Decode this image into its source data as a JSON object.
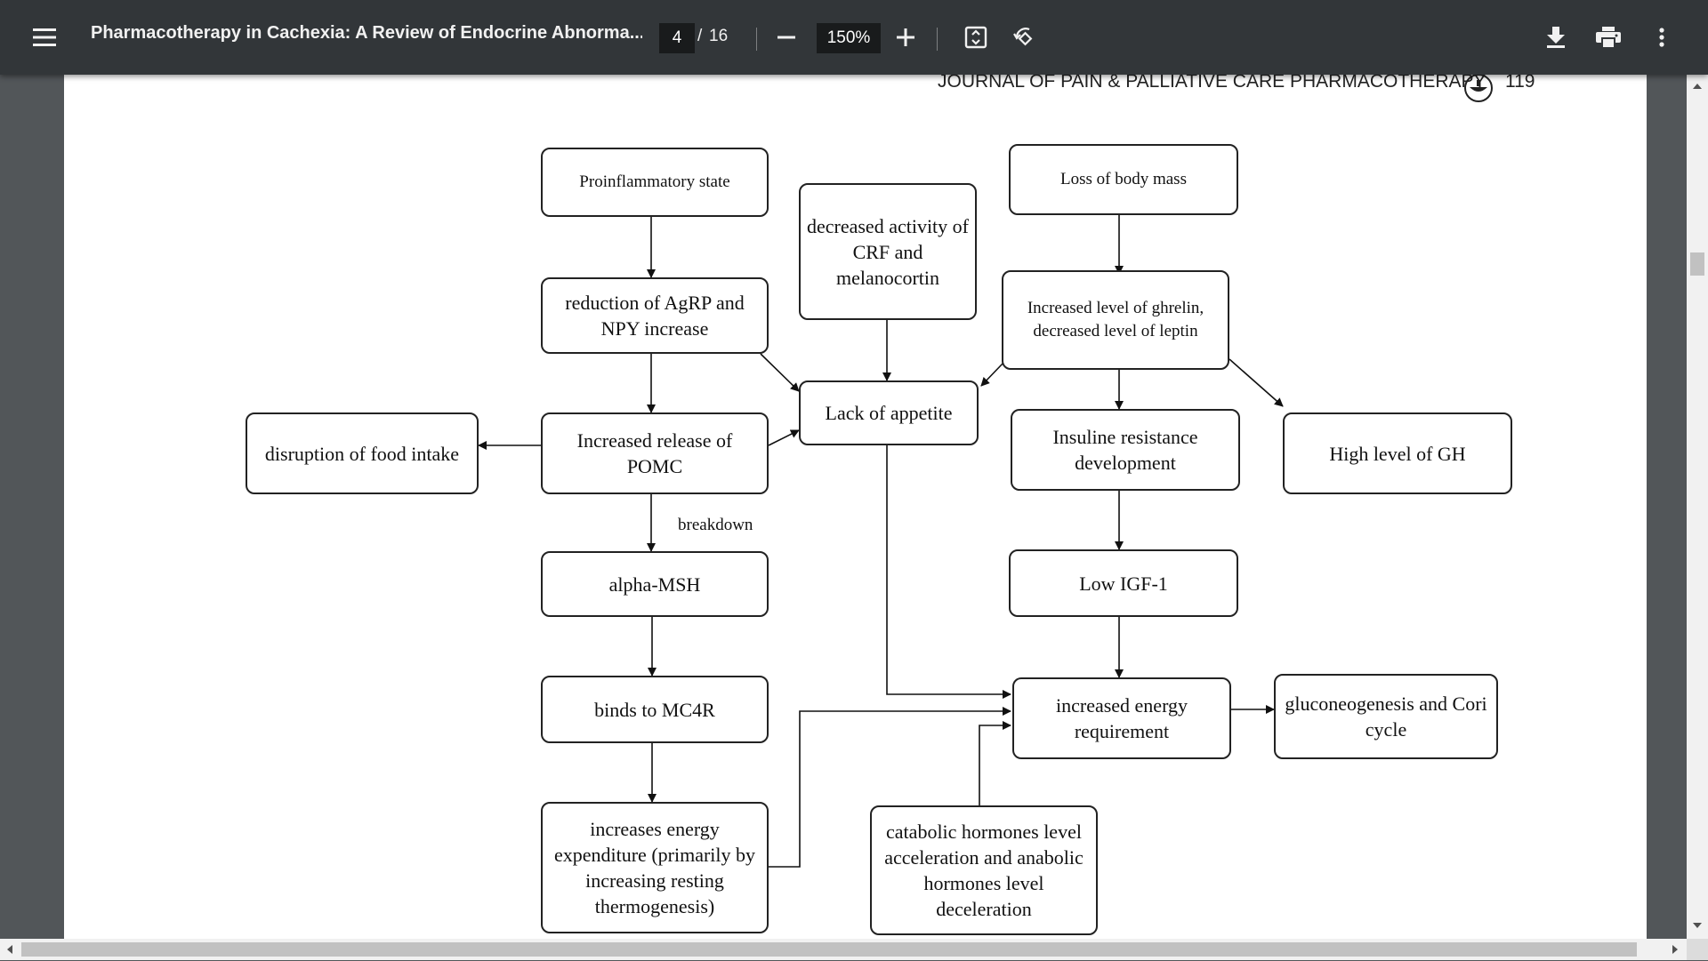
{
  "toolbar": {
    "menu_icon": "hamburger-menu-icon",
    "title": "Pharmacotherapy in Cachexia: A Review of Endocrine Abnorma...",
    "page_current": "4",
    "page_separator": "/",
    "page_total": "16",
    "zoom_out_icon": "minus-icon",
    "zoom_value": "150%",
    "zoom_in_icon": "plus-icon",
    "fit_icon": "fit-to-page-icon",
    "rotate_icon": "rotate-counterclockwise-icon",
    "download_icon": "download-icon",
    "print_icon": "print-icon",
    "more_icon": "more-vertical-icon"
  },
  "page": {
    "running_head": "JOURNAL OF PAIN & PALLIATIVE CARE PHARMACOTHERAPY",
    "page_number": "119",
    "publisher_logo": "publisher-logo-icon"
  },
  "diagram": {
    "proinflammatory": "Proinflammatory state",
    "agrp": "reduction of AgRP and NPY increase",
    "pomc": "Increased release of POMC",
    "disruption": "disruption of food intake",
    "breakdown": "breakdown",
    "alpha_msh": "alpha-MSH",
    "mc4r": "binds to MC4R",
    "energy_expenditure": "increases energy expenditure (primarily by increasing resting thermogenesis)",
    "crf": "decreased activity of CRF and melanocortin",
    "lack_appetite": "Lack of appetite",
    "catabolic": "catabolic hormones level acceleration and anabolic hormones level deceleration",
    "loss_body_mass": "Loss of body mass",
    "ghrelin": "Increased level of ghrelin, decreased level of leptin",
    "insulin": "Insuline resistance development",
    "low_igf": "Low IGF-1",
    "energy_requirement": "increased energy requirement",
    "high_gh": "High level of GH",
    "gluconeogenesis": "gluconeogenesis and Cori cycle"
  },
  "colors": {
    "toolbar_bg": "#323639",
    "viewer_bg": "#525659",
    "page_bg": "#ffffff"
  }
}
